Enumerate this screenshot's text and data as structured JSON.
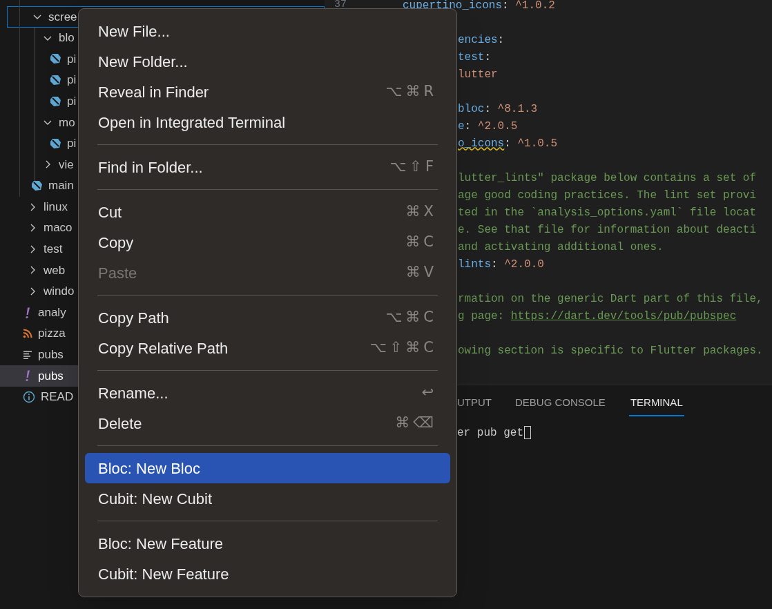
{
  "explorer": {
    "nested_items": [
      {
        "label": "scree",
        "kind": "folder",
        "expanded": true,
        "focused": true,
        "selected": false,
        "children": [
          {
            "label": "blo",
            "kind": "folder",
            "expanded": true,
            "focused": false,
            "selected": false,
            "children": [
              {
                "label": "pi",
                "kind": "dart",
                "focused": false,
                "selected": false
              },
              {
                "label": "pi",
                "kind": "dart",
                "focused": false,
                "selected": false
              },
              {
                "label": "pi",
                "kind": "dart",
                "focused": false,
                "selected": false
              }
            ]
          },
          {
            "label": "mo",
            "kind": "folder",
            "expanded": true,
            "focused": false,
            "selected": false,
            "children": [
              {
                "label": "pi",
                "kind": "dart",
                "focused": false,
                "selected": false
              }
            ]
          },
          {
            "label": "vie",
            "kind": "folder",
            "expanded": false,
            "focused": false,
            "selected": false
          }
        ]
      },
      {
        "label": "main",
        "kind": "dart",
        "focused": false,
        "selected": false
      }
    ],
    "root_items": [
      {
        "label": "linux",
        "kind": "folder",
        "expanded": false,
        "focused": false,
        "selected": false
      },
      {
        "label": "maco",
        "kind": "folder",
        "expanded": false,
        "focused": false,
        "selected": false
      },
      {
        "label": "test",
        "kind": "folder",
        "expanded": false,
        "focused": false,
        "selected": false
      },
      {
        "label": "web",
        "kind": "folder",
        "expanded": false,
        "focused": false,
        "selected": false
      },
      {
        "label": "windo",
        "kind": "folder",
        "expanded": false,
        "focused": false,
        "selected": false
      },
      {
        "label": "analy",
        "kind": "yaml",
        "focused": false,
        "selected": false
      },
      {
        "label": "pizza",
        "kind": "feed",
        "focused": false,
        "selected": false
      },
      {
        "label": "pubs",
        "kind": "lines",
        "focused": false,
        "selected": false
      },
      {
        "label": "pubs",
        "kind": "yaml",
        "focused": false,
        "selected": true
      },
      {
        "label": "READ",
        "kind": "info",
        "focused": false,
        "selected": false
      }
    ]
  },
  "editor": {
    "lines": [
      {
        "kind": "full",
        "number": "37",
        "segments": [
          {
            "kind": "key",
            "text": "cupertino_icons"
          },
          {
            "kind": "punct",
            "text": ": "
          },
          {
            "kind": "value",
            "text": "^1.0.2"
          }
        ]
      },
      {
        "kind": "blank"
      },
      {
        "kind": "cut",
        "segments": [
          {
            "kind": "key",
            "text": "encies"
          },
          {
            "kind": "punct",
            "text": ":"
          }
        ]
      },
      {
        "kind": "cut",
        "segments": [
          {
            "kind": "key",
            "text": "test"
          },
          {
            "kind": "punct",
            "text": ":"
          }
        ]
      },
      {
        "kind": "cut",
        "segments": [
          {
            "kind": "value",
            "text": "lutter"
          }
        ]
      },
      {
        "kind": "blank"
      },
      {
        "kind": "cut",
        "segments": [
          {
            "kind": "key",
            "text": "bloc"
          },
          {
            "kind": "punct",
            "text": ": "
          },
          {
            "kind": "value",
            "text": "^8.1.3"
          }
        ]
      },
      {
        "kind": "cut",
        "segments": [
          {
            "kind": "key",
            "text": "e"
          },
          {
            "kind": "punct",
            "text": ": "
          },
          {
            "kind": "value",
            "text": "^2.0.5"
          }
        ]
      },
      {
        "kind": "cut",
        "segments": [
          {
            "kind": "warning",
            "text": "o_icons"
          },
          {
            "kind": "punct",
            "text": ": "
          },
          {
            "kind": "value",
            "text": "^1.0.5"
          }
        ]
      },
      {
        "kind": "blank"
      },
      {
        "kind": "cut",
        "segments": [
          {
            "kind": "comment",
            "text": "lutter_lints\" package below contains a set of"
          }
        ]
      },
      {
        "kind": "cut",
        "segments": [
          {
            "kind": "comment",
            "text": "age good coding practices. The lint set provi"
          }
        ]
      },
      {
        "kind": "cut",
        "segments": [
          {
            "kind": "comment",
            "text": "ted in the `analysis_options.yaml` file locat"
          }
        ]
      },
      {
        "kind": "cut",
        "segments": [
          {
            "kind": "comment",
            "text": "e. See that file for information about deacti"
          }
        ]
      },
      {
        "kind": "cut",
        "segments": [
          {
            "kind": "comment",
            "text": "and activating additional ones."
          }
        ]
      },
      {
        "kind": "cut",
        "segments": [
          {
            "kind": "key",
            "text": "lints"
          },
          {
            "kind": "punct",
            "text": ": "
          },
          {
            "kind": "value",
            "text": "^2.0.0"
          }
        ]
      },
      {
        "kind": "blank"
      },
      {
        "kind": "cut",
        "segments": [
          {
            "kind": "comment",
            "text": "rmation on the generic Dart part of this file,"
          }
        ]
      },
      {
        "kind": "cut",
        "segments": [
          {
            "kind": "comment",
            "text": "g page: "
          },
          {
            "kind": "link",
            "text": "https://dart.dev/tools/pub/pubspec"
          }
        ]
      },
      {
        "kind": "blank"
      },
      {
        "kind": "cut",
        "segments": [
          {
            "kind": "comment",
            "text": "owing section is specific to Flutter packages."
          }
        ]
      }
    ]
  },
  "panel": {
    "tabs": [
      {
        "label": "UTPUT",
        "selected": false
      },
      {
        "label": "DEBUG CONSOLE",
        "selected": false
      },
      {
        "label": "TERMINAL",
        "selected": true
      }
    ],
    "terminal_text": "er pub get"
  },
  "context_menu": {
    "groups": [
      [
        {
          "label": "New File...",
          "disabled": false,
          "selected": false
        },
        {
          "label": "New Folder...",
          "disabled": false,
          "selected": false
        },
        {
          "label": "Reveal in Finder",
          "shortcut": "⌥⌘R",
          "disabled": false,
          "selected": false
        },
        {
          "label": "Open in Integrated Terminal",
          "disabled": false,
          "selected": false
        }
      ],
      [
        {
          "label": "Find in Folder...",
          "shortcut": "⌥⇧F",
          "disabled": false,
          "selected": false
        }
      ],
      [
        {
          "label": "Cut",
          "shortcut": "⌘X",
          "disabled": false,
          "selected": false
        },
        {
          "label": "Copy",
          "shortcut": "⌘C",
          "disabled": false,
          "selected": false
        },
        {
          "label": "Paste",
          "shortcut": "⌘V",
          "disabled": true,
          "selected": false
        }
      ],
      [
        {
          "label": "Copy Path",
          "shortcut": "⌥⌘C",
          "disabled": false,
          "selected": false
        },
        {
          "label": "Copy Relative Path",
          "shortcut": "⌥⇧⌘C",
          "disabled": false,
          "selected": false
        }
      ],
      [
        {
          "label": "Rename...",
          "shortcut": "↩",
          "disabled": false,
          "selected": false
        },
        {
          "label": "Delete",
          "shortcut": "⌘⌫",
          "disabled": false,
          "selected": false
        }
      ],
      [
        {
          "label": "Bloc: New Bloc",
          "disabled": false,
          "selected": true
        },
        {
          "label": "Cubit: New Cubit",
          "disabled": false,
          "selected": false
        }
      ],
      [
        {
          "label": "Bloc: New Feature",
          "disabled": false,
          "selected": false
        },
        {
          "label": "Cubit: New Feature",
          "disabled": false,
          "selected": false
        }
      ]
    ]
  }
}
